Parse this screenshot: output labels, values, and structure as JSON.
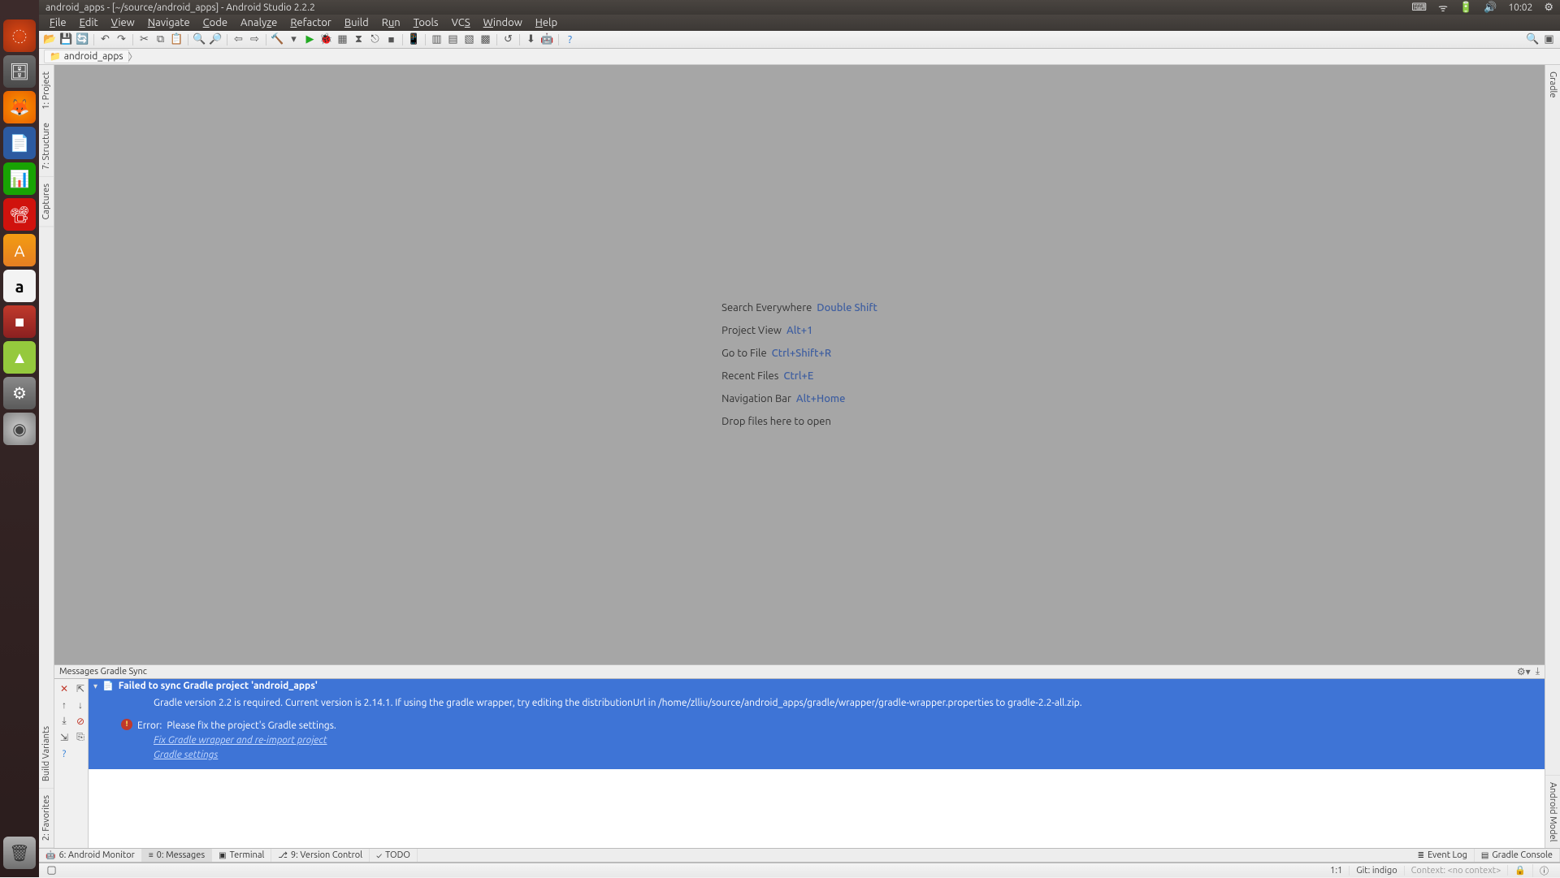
{
  "top_panel": {
    "title": "android_apps - [~/source/android_apps] - Android Studio 2.2.2",
    "time": "10:02"
  },
  "menu": {
    "file": "File",
    "edit": "Edit",
    "view": "View",
    "navigate": "Navigate",
    "code": "Code",
    "analyze": "Analyze",
    "refactor": "Refactor",
    "build": "Build",
    "run": "Run",
    "tools": "Tools",
    "vcs": "VCS",
    "window": "Window",
    "help": "Help"
  },
  "breadcrumb": {
    "project": "android_apps"
  },
  "left_gutter": {
    "project": "1: Project",
    "structure": "7: Structure",
    "captures": "Captures",
    "build_variants": "Build Variants",
    "favorites": "2: Favorites"
  },
  "right_gutter": {
    "gradle": "Gradle",
    "android_model": "Android Model"
  },
  "shortcuts": [
    {
      "label": "Search Everywhere",
      "key": "Double Shift"
    },
    {
      "label": "Project View",
      "key": "Alt+1"
    },
    {
      "label": "Go to File",
      "key": "Ctrl+Shift+R"
    },
    {
      "label": "Recent Files",
      "key": "Ctrl+E"
    },
    {
      "label": "Navigation Bar",
      "key": "Alt+Home"
    },
    {
      "label": "Drop files here to open",
      "key": ""
    }
  ],
  "messages": {
    "header": "Messages Gradle Sync",
    "title": "Failed to sync Gradle project 'android_apps'",
    "body_line": "Gradle version 2.2 is required. Current version is 2.14.1. If using the gradle wrapper, try editing the distributionUrl in /home/zlliu/source/android_apps/gradle/wrapper/gradle-wrapper.properties to gradle-2.2-all.zip.",
    "error_label": "Error:",
    "error_text": "Please fix the project's Gradle settings.",
    "link_fix": "Fix Gradle wrapper and re-import project",
    "link_settings": "Gradle settings"
  },
  "bottom_tabs": {
    "android_monitor": "6: Android Monitor",
    "messages": "0: Messages",
    "terminal": "Terminal",
    "version_control": "9: Version Control",
    "todo": "TODO",
    "event_log": "Event Log",
    "gradle_console": "Gradle Console"
  },
  "statusbar": {
    "pos": "1:1",
    "git": "Git: indigo",
    "context": "Context: <no context>"
  }
}
